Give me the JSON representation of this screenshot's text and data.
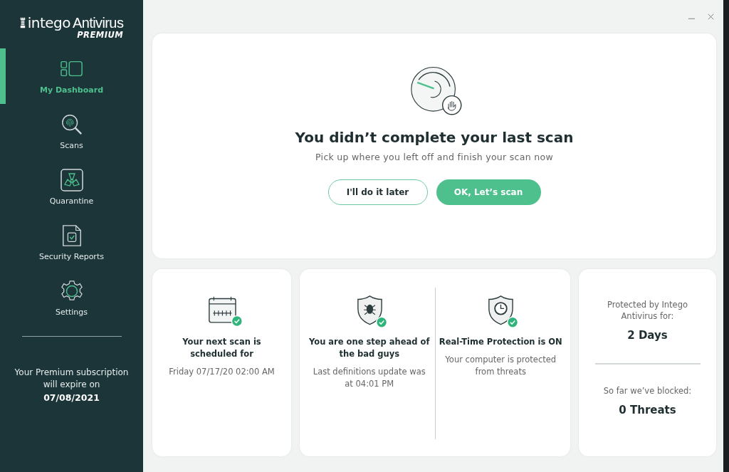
{
  "logo": {
    "brand": "intego",
    "product": "Antivirus",
    "tier": "PREMIUM"
  },
  "nav": [
    {
      "kind": "dashboard",
      "label": "My Dashboard",
      "selected": true
    },
    {
      "kind": "scans",
      "label": "Scans",
      "selected": false
    },
    {
      "kind": "quarantine",
      "label": "Quarantine",
      "selected": false
    },
    {
      "kind": "reports",
      "label": "Security Reports",
      "selected": false
    },
    {
      "kind": "settings",
      "label": "Settings",
      "selected": false
    }
  ],
  "subscription": {
    "text": "Your Premium subscription will expire on",
    "date": "07/08/2021"
  },
  "alert": {
    "title": "You didn’t complete your last scan",
    "subtitle": "Pick up where you left off and finish your scan now",
    "buttons": [
      {
        "kind": "secondary",
        "label": "I'll do it later"
      },
      {
        "kind": "primary",
        "label": "OK, Let’s scan"
      }
    ]
  },
  "status_cards": [
    {
      "items": [
        {
          "kind": "calendar",
          "title": "Your next scan is scheduled for",
          "detail": "Friday 07/17/20 02:00 AM"
        }
      ]
    },
    {
      "items": [
        {
          "kind": "bug-shield",
          "title": "You are one step ahead of the bad guys",
          "detail": "Last definitions update was at 04:01 PM"
        },
        {
          "kind": "clock-shield",
          "title": "Real-Time Protection is ON",
          "detail": "Your computer is protected from threats"
        }
      ]
    }
  ],
  "stats": [
    {
      "label": "Protected by Intego Antivirus for:",
      "value": "2 Days"
    },
    {
      "label": "So far we’ve blocked:",
      "value": "0 Threats"
    }
  ]
}
